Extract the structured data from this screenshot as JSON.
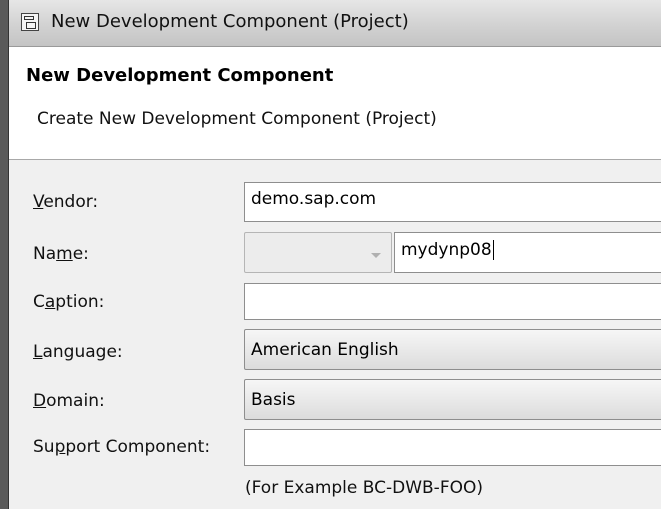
{
  "window": {
    "title": "New Development Component (Project)",
    "icon": "wizard-window-icon"
  },
  "header": {
    "title": "New Development Component",
    "description": "Create New Development Component (Project)"
  },
  "form": {
    "vendor": {
      "label_pre": "",
      "label_key": "V",
      "label_post": "endor:",
      "value": "demo.sap.com"
    },
    "name": {
      "label_pre": "Na",
      "label_key": "m",
      "label_post": "e:",
      "prefix_value": "",
      "value": "mydynp08"
    },
    "caption": {
      "label_pre": "C",
      "label_key": "a",
      "label_post": "ption:",
      "value": ""
    },
    "language": {
      "label_pre": "",
      "label_key": "L",
      "label_post": "anguage:",
      "value": "American English"
    },
    "domain": {
      "label_pre": "",
      "label_key": "D",
      "label_post": "omain:",
      "value": "Basis"
    },
    "support_component": {
      "label_pre": "Su",
      "label_key": "p",
      "label_post": "port Component:",
      "value": ""
    },
    "hint": "(For Example BC-DWB-FOO)"
  }
}
